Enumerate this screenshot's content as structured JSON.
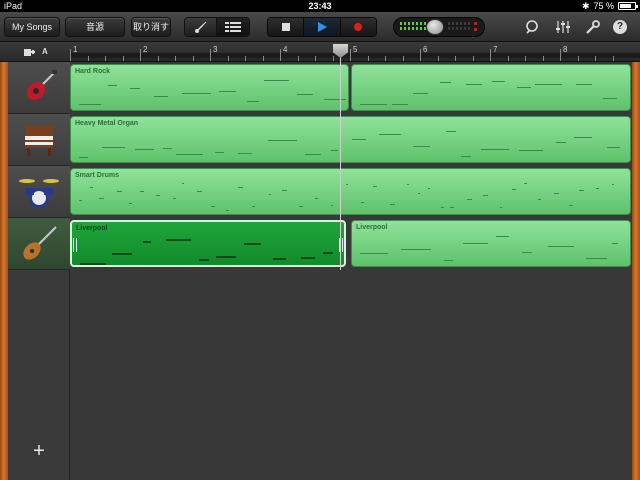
{
  "statusbar": {
    "device": "iPad",
    "time": "23:43",
    "battery": "75 %",
    "battery_level": 0.75
  },
  "toolbar": {
    "my_songs": "My Songs",
    "sound_source": "音源",
    "undo": "取り消す",
    "view_instrument_icon": "guitar-icon",
    "view_tracks_icon": "tracks-list-icon",
    "loop_icon": "loop-icon",
    "mixer_icon": "mixer-icon",
    "settings_icon": "wrench-icon",
    "help_label": "?"
  },
  "ruler": {
    "header_label": "A",
    "bars": [
      "1",
      "2",
      "3",
      "4",
      "5",
      "6",
      "7",
      "8"
    ]
  },
  "tracks": [
    {
      "instrument_icon": "electric-guitar-icon",
      "regions": [
        {
          "name": "Hard Rock"
        },
        {
          "name": ""
        }
      ]
    },
    {
      "instrument_icon": "organ-icon",
      "regions": [
        {
          "name": "Heavy Metal Organ"
        }
      ]
    },
    {
      "instrument_icon": "drum-kit-icon",
      "regions": [
        {
          "name": "Smart Drums"
        }
      ]
    },
    {
      "instrument_icon": "bass-guitar-icon",
      "regions": [
        {
          "name": "Liverpool"
        },
        {
          "name": "Liverpool"
        }
      ]
    }
  ],
  "add_track_label": "+",
  "colors": {
    "region": "#7cd88a",
    "region_selected": "#1a9a34",
    "wood": "#c86a22"
  }
}
